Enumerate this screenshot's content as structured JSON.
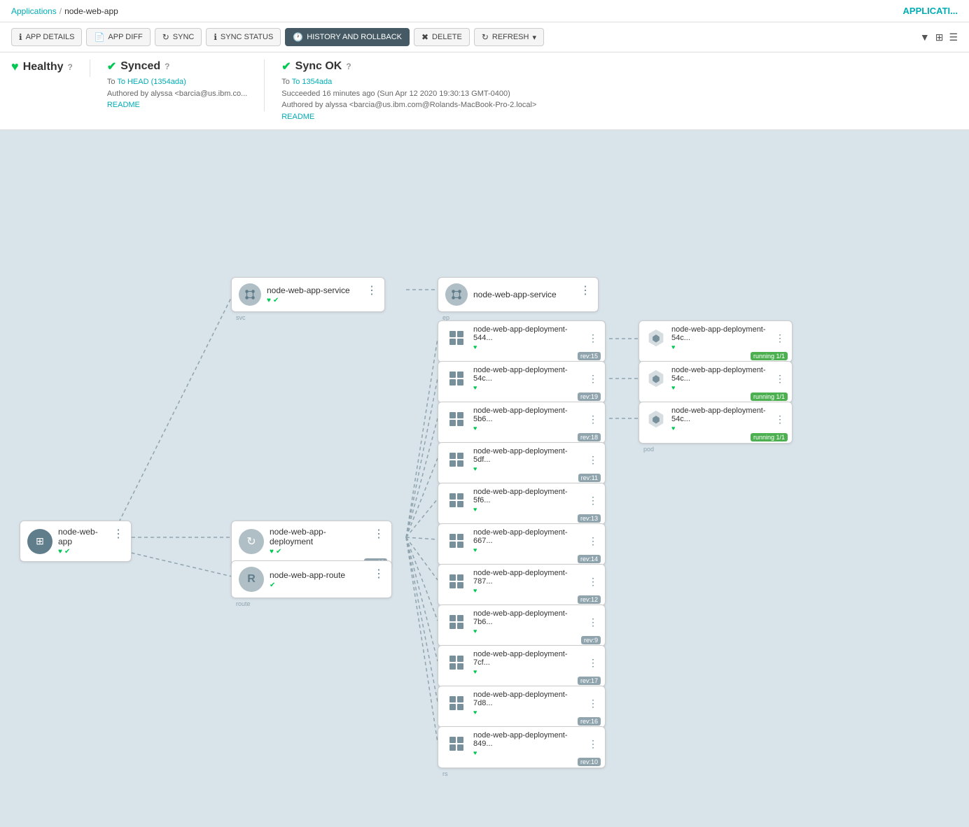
{
  "breadcrumb": {
    "applications_label": "Applications",
    "separator": "/",
    "current_app": "node-web-app"
  },
  "app_title_right": "APPLICATI...",
  "toolbar": {
    "app_details": "APP DETAILS",
    "app_diff": "APP DIFF",
    "sync": "SYNC",
    "sync_status": "SYNC STATUS",
    "history_rollback": "HISTORY AND ROLLBACK",
    "delete": "DELETE",
    "refresh": "REFRESH"
  },
  "status": {
    "healthy_label": "Healthy",
    "synced_label": "Synced",
    "synced_to": "To HEAD (1354ada)",
    "synced_author": "Authored by alyssa <barcia@us.ibm.co...",
    "synced_readme": "README",
    "syncok_label": "Sync OK",
    "syncok_to": "To 1354ada",
    "syncok_succeeded": "Succeeded 16 minutes ago (Sun Apr 12 2020 19:30:13 GMT-0400)",
    "syncok_author": "Authored by alyssa <barcia@us.ibm.com@Rolands-MacBook-Pro-2.local>",
    "syncok_readme": "README"
  },
  "nodes": {
    "main_app": {
      "label": "node-web-app",
      "type": "app"
    },
    "deployment": {
      "label": "node-web-app-deployment",
      "type": "deploy",
      "rev": "rev:19"
    },
    "route": {
      "label": "node-web-app-route",
      "type": "route"
    },
    "svc_left": {
      "label": "node-web-app-service",
      "type": "svc"
    },
    "svc_right": {
      "label": "node-web-app-service",
      "type": "ep"
    },
    "rs": [
      {
        "label": "node-web-app-deployment-544...",
        "rev": "rev:15"
      },
      {
        "label": "node-web-app-deployment-54c...",
        "rev": "rev:19"
      },
      {
        "label": "node-web-app-deployment-5b6...",
        "rev": "rev:18"
      },
      {
        "label": "node-web-app-deployment-5df...",
        "rev": "rev:11"
      },
      {
        "label": "node-web-app-deployment-5f6...",
        "rev": "rev:13"
      },
      {
        "label": "node-web-app-deployment-667...",
        "rev": "rev:14"
      },
      {
        "label": "node-web-app-deployment-787...",
        "rev": "rev:12"
      },
      {
        "label": "node-web-app-deployment-7b6...",
        "rev": "rev:9"
      },
      {
        "label": "node-web-app-deployment-7cf...",
        "rev": "rev:17"
      },
      {
        "label": "node-web-app-deployment-7d8...",
        "rev": "rev:16"
      },
      {
        "label": "node-web-app-deployment-849...",
        "rev": "rev:10"
      }
    ],
    "pods": [
      {
        "label": "node-web-app-deployment-54c...",
        "status": "running 1/1"
      },
      {
        "label": "node-web-app-deployment-54c...",
        "status": "running 1/1"
      },
      {
        "label": "node-web-app-deployment-54c...",
        "status": "running 1/1"
      }
    ]
  }
}
